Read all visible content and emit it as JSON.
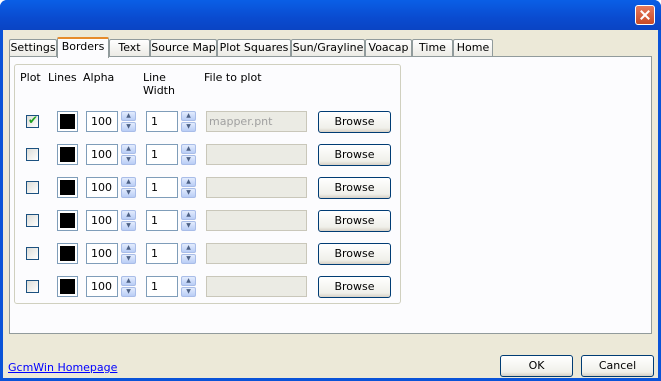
{
  "window": {
    "title": ""
  },
  "tabs": [
    "Settings",
    "Borders",
    "Text",
    "Source Map",
    "Plot Squares",
    "Sun/Grayline",
    "Voacap",
    "Time",
    "Home"
  ],
  "active_tab": "Borders",
  "headers": {
    "plot": "Plot",
    "lines": "Lines",
    "alpha": "Alpha",
    "line_width_1": "Line",
    "line_width_2": "Width",
    "file": "File to plot"
  },
  "rows": [
    {
      "plot": true,
      "line_color": "#000000",
      "alpha": "100",
      "width": "1",
      "file": "mapper.pnt",
      "browse": "Browse"
    },
    {
      "plot": false,
      "line_color": "#000000",
      "alpha": "100",
      "width": "1",
      "file": "",
      "browse": "Browse"
    },
    {
      "plot": false,
      "line_color": "#000000",
      "alpha": "100",
      "width": "1",
      "file": "",
      "browse": "Browse"
    },
    {
      "plot": false,
      "line_color": "#000000",
      "alpha": "100",
      "width": "1",
      "file": "",
      "browse": "Browse"
    },
    {
      "plot": false,
      "line_color": "#000000",
      "alpha": "100",
      "width": "1",
      "file": "",
      "browse": "Browse"
    },
    {
      "plot": false,
      "line_color": "#000000",
      "alpha": "100",
      "width": "1",
      "file": "",
      "browse": "Browse"
    }
  ],
  "footer": {
    "link": "GcmWin Homepage",
    "ok": "OK",
    "cancel": "Cancel"
  },
  "icons": {
    "close": "close-icon",
    "spin_up": "spin-up-icon",
    "spin_down": "spin-down-icon",
    "check": "checkmark-icon"
  }
}
